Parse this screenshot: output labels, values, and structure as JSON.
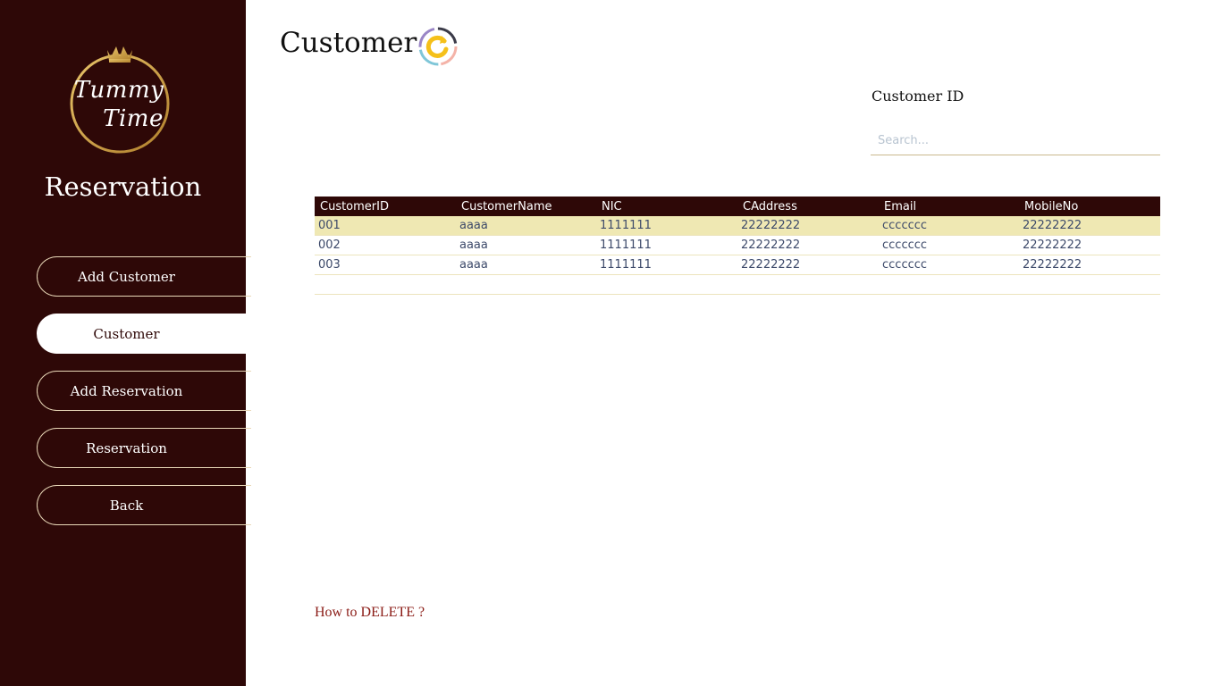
{
  "sidebar": {
    "logo": {
      "line1": "Tummy",
      "line2": "Time"
    },
    "title": "Reservation",
    "items": [
      {
        "label": "Add Customer",
        "active": false
      },
      {
        "label": "Customer",
        "active": true
      },
      {
        "label": "Add Reservation",
        "active": false
      },
      {
        "label": "Reservation",
        "active": false
      },
      {
        "label": "Back",
        "active": false
      }
    ]
  },
  "main": {
    "title": "Customer",
    "refresh_icon": "refresh-icon",
    "search": {
      "label": "Customer ID",
      "placeholder": "Search...",
      "value": ""
    },
    "table": {
      "columns": [
        "CustomerID",
        "CustomerName",
        "NIC",
        "CAddress",
        "Email",
        "MobileNo"
      ],
      "rows": [
        [
          "001",
          "aaaa",
          "1111111",
          "22222222",
          "ccccccc",
          "22222222"
        ],
        [
          "002",
          "aaaa",
          "1111111",
          "22222222",
          "ccccccc",
          "22222222"
        ],
        [
          "003",
          "aaaa",
          "1111111",
          "22222222",
          "ccccccc",
          "22222222"
        ]
      ],
      "selected_row": 0
    },
    "help_link": "How to DELETE ?"
  },
  "colors": {
    "sidebar_bg": "#2e0807",
    "gold": "#c9a24a",
    "selected_row": "#efe8b3",
    "link": "#8a1a14"
  }
}
